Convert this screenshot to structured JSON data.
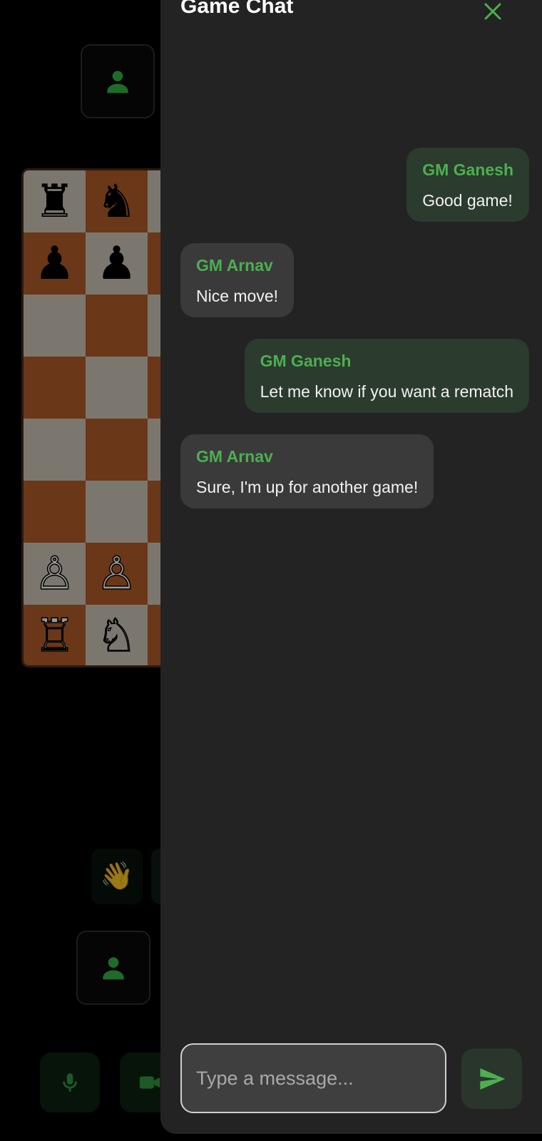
{
  "chat": {
    "title": "Game Chat",
    "messages": [
      {
        "sender": "GM Ganesh",
        "text": "Good game!",
        "side": "mine"
      },
      {
        "sender": "GM Arnav",
        "text": "Nice move!",
        "side": "theirs"
      },
      {
        "sender": "GM Ganesh",
        "text": "Let me know if you want a rematch",
        "side": "mine"
      },
      {
        "sender": "GM Arnav",
        "text": "Sure, I'm up for another game!",
        "side": "theirs"
      }
    ],
    "input_placeholder": "Type a message...",
    "input_value": ""
  },
  "board": {
    "rows": [
      [
        "♜",
        "♞",
        "",
        ""
      ],
      [
        "♟",
        "♟",
        "",
        ""
      ],
      [
        "",
        "",
        "",
        ""
      ],
      [
        "",
        "",
        "",
        ""
      ],
      [
        "",
        "",
        "",
        ""
      ],
      [
        "",
        "",
        "",
        ""
      ],
      [
        "♙",
        "♙",
        "",
        ""
      ],
      [
        "♖",
        "♘",
        "",
        ""
      ]
    ]
  },
  "controls": {
    "reaction_emoji": "👋"
  },
  "icons": {
    "opponent_avatar": "person-icon",
    "player_avatar": "person-icon",
    "close": "close-icon",
    "send": "send-icon",
    "mic": "microphone-icon",
    "video": "video-camera-icon"
  },
  "colors": {
    "accent": "#4caf50",
    "panel_bg": "#232323",
    "my_bubble": "#2b3b2d",
    "their_bubble": "#3a3a3a",
    "board_light": "#7c776e",
    "board_dark": "#6a3719"
  }
}
